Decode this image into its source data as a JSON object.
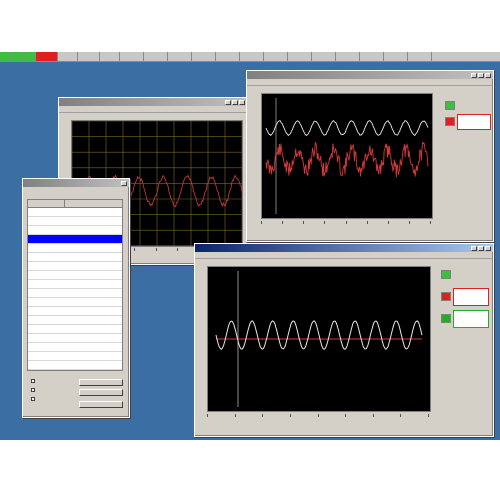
{
  "taskbar": {
    "cells": [
      {
        "label": "",
        "color": "#3cbf3c"
      },
      {
        "label": "",
        "color": "#3cbf3c"
      },
      {
        "label": "",
        "color": "#3cbf3c"
      },
      {
        "label": "",
        "color": "#e02020"
      },
      {
        "label": "",
        "color": "#c8c8c8"
      },
      {
        "label": "",
        "color": "#c8c8c8"
      },
      {
        "label": "",
        "color": "#c8c8c8"
      },
      {
        "label": "",
        "color": "#c8c8c8"
      },
      {
        "label": "",
        "color": "#c8c8c8"
      },
      {
        "label": "",
        "color": "#c8c8c8"
      },
      {
        "label": "",
        "color": "#c8c8c8"
      },
      {
        "label": "",
        "color": "#c8c8c8"
      },
      {
        "label": "",
        "color": "#c8c8c8"
      },
      {
        "label": "",
        "color": "#c8c8c8"
      },
      {
        "label": "",
        "color": "#c8c8c8"
      },
      {
        "label": "",
        "color": "#c8c8c8"
      },
      {
        "label": "",
        "color": "#c8c8c8"
      },
      {
        "label": "",
        "color": "#c8c8c8"
      },
      {
        "label": "",
        "color": "#c8c8c8"
      },
      {
        "label": "",
        "color": "#c8c8c8"
      }
    ]
  },
  "windows": {
    "scope_grid": {
      "title": ""
    },
    "scope_top_right": {
      "title": ""
    },
    "scope_bottom_right": {
      "title": ""
    },
    "channel_list": {
      "title": ""
    }
  },
  "channel_list": {
    "columns": [
      "",
      ""
    ],
    "rows": [
      {
        "name": "",
        "value": "",
        "selected": false
      },
      {
        "name": "",
        "value": "",
        "selected": false
      },
      {
        "name": "",
        "value": "",
        "selected": false
      },
      {
        "name": "",
        "value": "",
        "selected": true
      },
      {
        "name": "",
        "value": "",
        "selected": false
      },
      {
        "name": "",
        "value": "",
        "selected": false
      },
      {
        "name": "",
        "value": "",
        "selected": false
      },
      {
        "name": "",
        "value": "",
        "selected": false
      },
      {
        "name": "",
        "value": "",
        "selected": false
      },
      {
        "name": "",
        "value": "",
        "selected": false
      },
      {
        "name": "",
        "value": "",
        "selected": false
      },
      {
        "name": "",
        "value": "",
        "selected": false
      }
    ],
    "checkboxes": [
      "",
      "",
      ""
    ],
    "buttons": [
      "",
      "",
      ""
    ]
  },
  "colors": {
    "desktop": "#3b6ea2",
    "trace_white": "#e8e8e8",
    "trace_red": "#d23a3a",
    "trace_olive_grid": "#7a6a2a",
    "indicator_red": "#e02020",
    "indicator_green": "#22b022",
    "selection": "#0000ff"
  }
}
